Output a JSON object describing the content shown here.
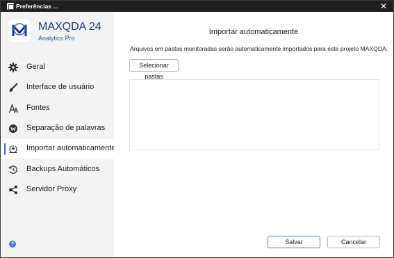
{
  "window": {
    "title": "Preferências ...",
    "close_glyph": "✕"
  },
  "brand": {
    "name": "MAXQDA 24",
    "edition": "Analytics Pro"
  },
  "sidebar": {
    "items": [
      {
        "label": "Geral",
        "icon": "gear-icon",
        "active": false
      },
      {
        "label": "Interface de usuário",
        "icon": "brush-icon",
        "active": false
      },
      {
        "label": "Fontes",
        "icon": "font-icon",
        "active": false
      },
      {
        "label": "Separação de palavras",
        "icon": "hyphenation-icon",
        "active": false
      },
      {
        "label": "Importar automaticamente",
        "icon": "auto-import-icon",
        "active": true
      },
      {
        "label": "Backups Automáticos",
        "icon": "backup-history-icon",
        "active": false
      },
      {
        "label": "Servidor Proxy",
        "icon": "share-nodes-icon",
        "active": false
      }
    ],
    "help_glyph": "?"
  },
  "main": {
    "heading": "Importar automaticamente",
    "description": "Arquivos em pastas monitoradas serão automaticamente importados para este projeto MAXQDA.",
    "select_folders_label": "Selecionar pastas",
    "save_label": "Salvar",
    "cancel_label": "Cancelar"
  },
  "colors": {
    "accent": "#3c68c4",
    "brand_text": "#1f3c78",
    "titlebar": "#202020",
    "sidebar_bg": "#f3f3f3"
  }
}
